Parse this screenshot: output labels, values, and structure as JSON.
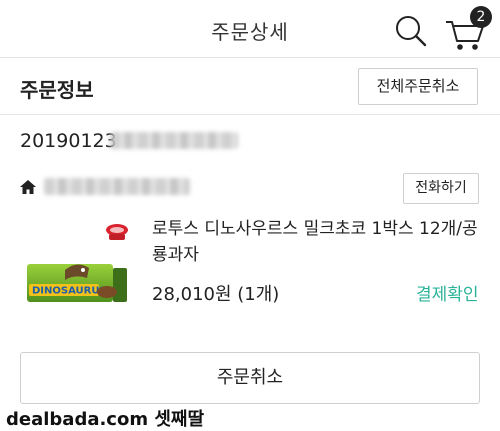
{
  "header": {
    "title": "주문상세",
    "cart_count": "2"
  },
  "order_info": {
    "section_title": "주문정보",
    "cancel_all_label": "전체주문취소",
    "order_number": "20190123",
    "call_label": "전화하기"
  },
  "product": {
    "name": "로투스 디노사우르스 밀크초코 1박스 12개/공룡과자",
    "price": "28,010원 (1개)",
    "status": "결제확인",
    "image_text": "DINOSAURUS"
  },
  "order_cancel_label": "주문취소",
  "watermark": "dealbada.com 셋째딸",
  "colors": {
    "status": "#2bb39a",
    "badge": "#222222"
  },
  "icons": [
    "search-icon",
    "cart-icon",
    "home-icon"
  ]
}
